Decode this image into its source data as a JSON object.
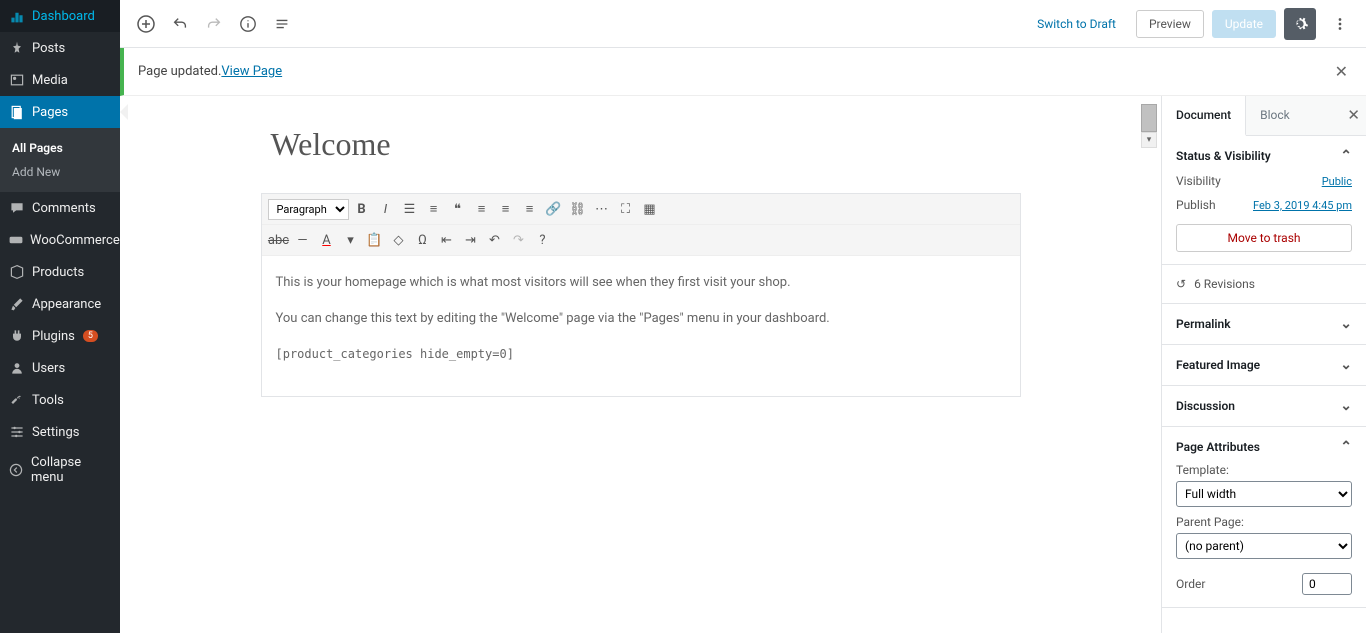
{
  "sidebar": {
    "items": [
      {
        "label": "Dashboard",
        "icon": "dashboard"
      },
      {
        "label": "Posts",
        "icon": "pin"
      },
      {
        "label": "Media",
        "icon": "media"
      },
      {
        "label": "Pages",
        "icon": "pages",
        "active": true
      },
      {
        "label": "Comments",
        "icon": "comment"
      },
      {
        "label": "WooCommerce",
        "icon": "woo"
      },
      {
        "label": "Products",
        "icon": "box"
      },
      {
        "label": "Appearance",
        "icon": "brush"
      },
      {
        "label": "Plugins",
        "icon": "plug",
        "badge": "5"
      },
      {
        "label": "Users",
        "icon": "user"
      },
      {
        "label": "Tools",
        "icon": "wrench"
      },
      {
        "label": "Settings",
        "icon": "sliders"
      },
      {
        "label": "Collapse menu",
        "icon": "collapse"
      }
    ],
    "sub": [
      {
        "label": "All Pages",
        "active": true
      },
      {
        "label": "Add New"
      }
    ]
  },
  "topbar": {
    "switch_draft": "Switch to Draft",
    "preview": "Preview",
    "update": "Update"
  },
  "notice": {
    "text": "Page updated. ",
    "link": "View Page"
  },
  "editor": {
    "title": "Welcome",
    "format_dropdown": "Paragraph",
    "body": {
      "p1": "This is your homepage which is what most visitors will see when they first visit your shop.",
      "p2": "You can change this text by editing the \"Welcome\" page via the \"Pages\" menu in your dashboard.",
      "p3": "[product_categories hide_empty=0]"
    }
  },
  "panel": {
    "tabs": {
      "document": "Document",
      "block": "Block"
    },
    "status": {
      "title": "Status & Visibility",
      "visibility_label": "Visibility",
      "visibility_value": "Public",
      "publish_label": "Publish",
      "publish_value": "Feb 3, 2019 4:45 pm",
      "trash": "Move to trash"
    },
    "revisions_count": "6 Revisions",
    "permalink": "Permalink",
    "featured": "Featured Image",
    "discussion": "Discussion",
    "attributes": {
      "title": "Page Attributes",
      "template_label": "Template:",
      "template_value": "Full width",
      "parent_label": "Parent Page:",
      "parent_value": "(no parent)",
      "order_label": "Order",
      "order_value": "0"
    }
  }
}
